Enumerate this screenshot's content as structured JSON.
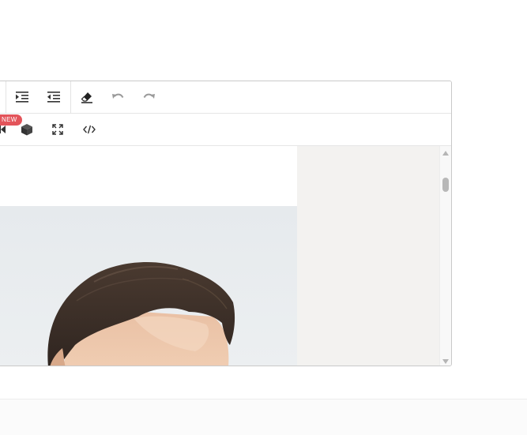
{
  "toolbar": {
    "row1": [
      {
        "name": "indent-button",
        "icon": "indent-icon"
      },
      {
        "name": "outdent-button",
        "icon": "outdent-icon"
      },
      {
        "name": "remove-format-button",
        "icon": "eraser-icon"
      },
      {
        "name": "undo-button",
        "icon": "undo-icon"
      },
      {
        "name": "redo-button",
        "icon": "redo-icon"
      }
    ],
    "row2": [
      {
        "name": "media-button",
        "icon": "video-icon"
      },
      {
        "name": "3d-model-button",
        "icon": "cube-icon"
      },
      {
        "name": "fullscreen-button",
        "icon": "expand-icon"
      },
      {
        "name": "source-code-button",
        "icon": "code-icon"
      }
    ],
    "new_badge": "NEW"
  },
  "content": {
    "image": "portrait-photo-man"
  },
  "colors": {
    "badge": "#e3545a",
    "icon": "#333333",
    "icon_disabled": "#9a9a9a",
    "workspace": "#f3f2f0"
  }
}
